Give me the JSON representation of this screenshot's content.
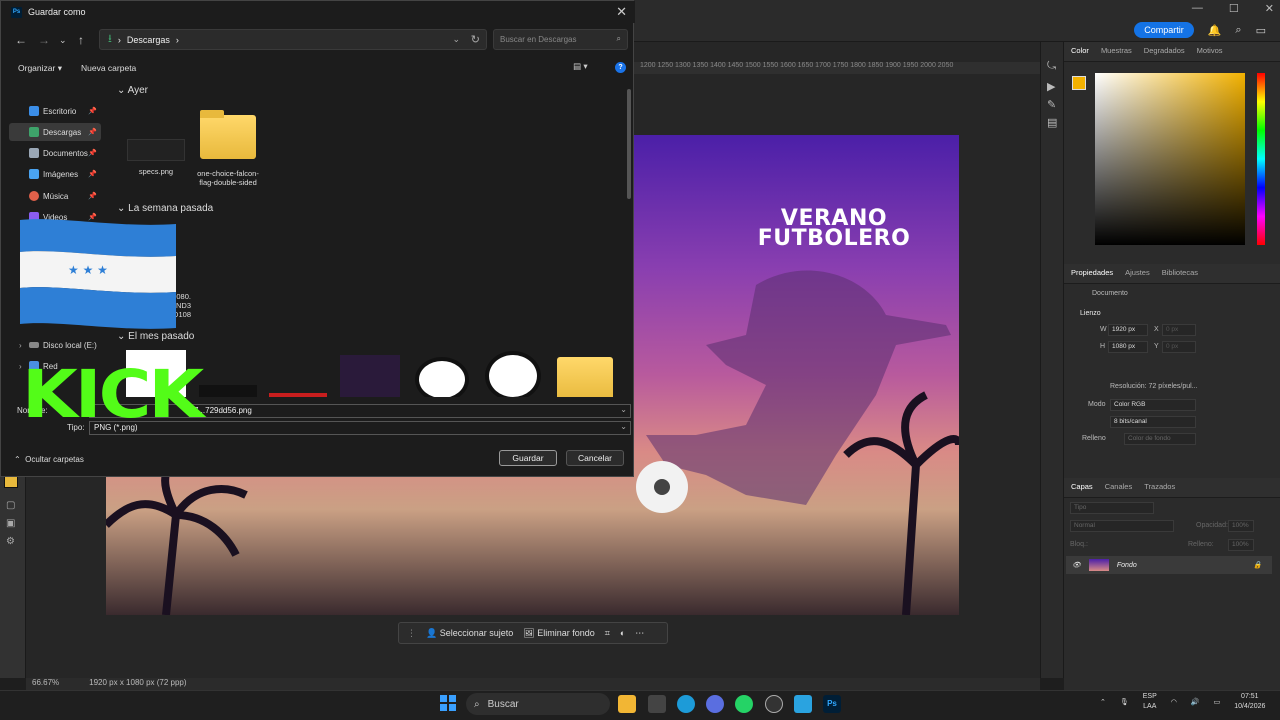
{
  "photoshop": {
    "share_label": "Compartir",
    "ruler_ticks": "1200  1250  1300  1350  1400  1450  1500  1550  1600  1650  1700  1750  1800  1850  1900  1950  2000  2050",
    "headline": "VERANO FUTBOLERO",
    "contextual_bar": {
      "select_subject": "Seleccionar sujeto",
      "remove_bg": "Eliminar fondo"
    },
    "status": {
      "zoom": "66.67%",
      "doc_info": "1920 px x 1080 px (72 ppp)"
    },
    "color_panel": {
      "tabs": [
        "Color",
        "Muestras",
        "Degradados",
        "Motivos"
      ],
      "foreground": "#f2b100"
    },
    "properties_panel": {
      "tabs": [
        "Propiedades",
        "Ajustes",
        "Bibliotecas"
      ],
      "document_label": "Documento",
      "canvas_label": "Lienzo",
      "width_label": "W",
      "width_value": "1920 px",
      "height_label": "H",
      "height_value": "1080 px",
      "x_label": "X",
      "y_label": "Y",
      "x_placeholder": "0 px",
      "y_placeholder": "0 px",
      "resolution": "Resolución: 72 píxeles/pul...",
      "mode_label": "Modo",
      "mode_value": "Color RGB",
      "depth_value": "8 bits/canal",
      "fill_label": "Relleno",
      "fill_value": "Color de fondo"
    },
    "layers_panel": {
      "tabs": [
        "Capas",
        "Canales",
        "Trazados"
      ],
      "filter_placeholder": "Tipo",
      "blend_mode": "Normal",
      "opacity_label": "Opacidad:",
      "opacity_value": "100%",
      "lock_label": "Bloq.:",
      "fill_label": "Relleno:",
      "fill_value": "100%",
      "layer_name": "Fondo"
    }
  },
  "taskbar": {
    "search_label": "Buscar",
    "lang": "ESP",
    "lang_sub": "LAA",
    "time": "07:51",
    "date": "10/4/2026"
  },
  "dialog": {
    "title": "Guardar como",
    "address": "Descargas",
    "search_placeholder": "Buscar en Descargas",
    "organize": "Organizar",
    "new_folder": "Nueva carpeta",
    "sidebar": [
      {
        "label": "Escritorio",
        "icon_color": "#3b8ee8"
      },
      {
        "label": "Descargas",
        "icon_color": "#3ea36a"
      },
      {
        "label": "Documentos",
        "icon_color": "#9aa7b6"
      },
      {
        "label": "Imágenes",
        "icon_color": "#4aa3f0"
      },
      {
        "label": "Música",
        "icon_color": "#e0604a"
      },
      {
        "label": "Videos",
        "icon_color": "#8a5cf0"
      },
      {
        "label": "Disco local (E:)",
        "icon_color": "#888888"
      },
      {
        "label": "Red",
        "icon_color": "#4a8fe0"
      }
    ],
    "groups": [
      "Ayer",
      "La semana pasada",
      "El mes pasado"
    ],
    "files_yesterday": [
      {
        "name": "specs.png"
      },
      {
        "name": "one-choice-falcon-flag-double-sided"
      }
    ],
    "files_lastweek": [
      {
        "name": "080.\nND3\n0D108"
      }
    ],
    "filename_label": "Nombre:",
    "filename_value": "7...729dd56.png",
    "type_label": "Tipo:",
    "type_value": "PNG (*.png)",
    "hide_folders": "Ocultar carpetas",
    "save": "Guardar",
    "cancel": "Cancelar"
  },
  "overlay": {
    "kick_text": "KICK"
  }
}
